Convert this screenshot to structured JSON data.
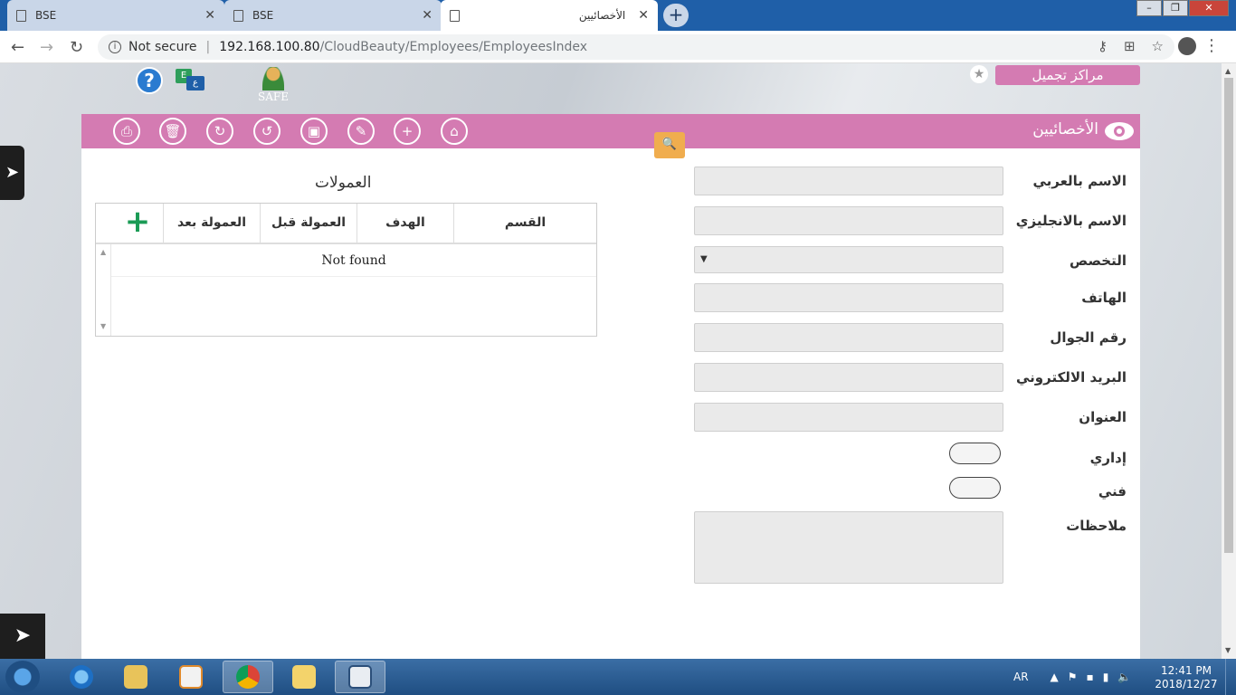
{
  "browser": {
    "tabs": [
      {
        "title": "BSE",
        "active": false
      },
      {
        "title": "BSE",
        "active": false
      },
      {
        "title": "الأخصائيين",
        "active": true
      }
    ],
    "security_label": "Not secure",
    "url_host": "192.168.100.80",
    "url_path": "/CloudBeauty/Employees/EmployeesIndex"
  },
  "header": {
    "safe_label": "SAFE",
    "brand": "مراكز تجميل",
    "lang_a": "E",
    "lang_b": "ع"
  },
  "toolbar": {
    "page_title": "الأخصائيين"
  },
  "form": {
    "labels": {
      "name_ar": "الاسم بالعربي",
      "name_en": "الاسم بالانجليزي",
      "specialty": "التخصص",
      "phone": "الهاتف",
      "mobile": "رقم الجوال",
      "email": "البريد الالكتروني",
      "address": "العنوان",
      "admin": "إداري",
      "tech": "فني",
      "notes": "ملاحظات"
    }
  },
  "commissions": {
    "title": "العمولات",
    "columns": [
      "القسم",
      "الهدف",
      "العمولة قبل",
      "العمولة بعد"
    ],
    "empty_text": "Not found"
  },
  "taskbar": {
    "lang": "AR",
    "time": "12:41 PM",
    "date": "2018/12/27"
  }
}
